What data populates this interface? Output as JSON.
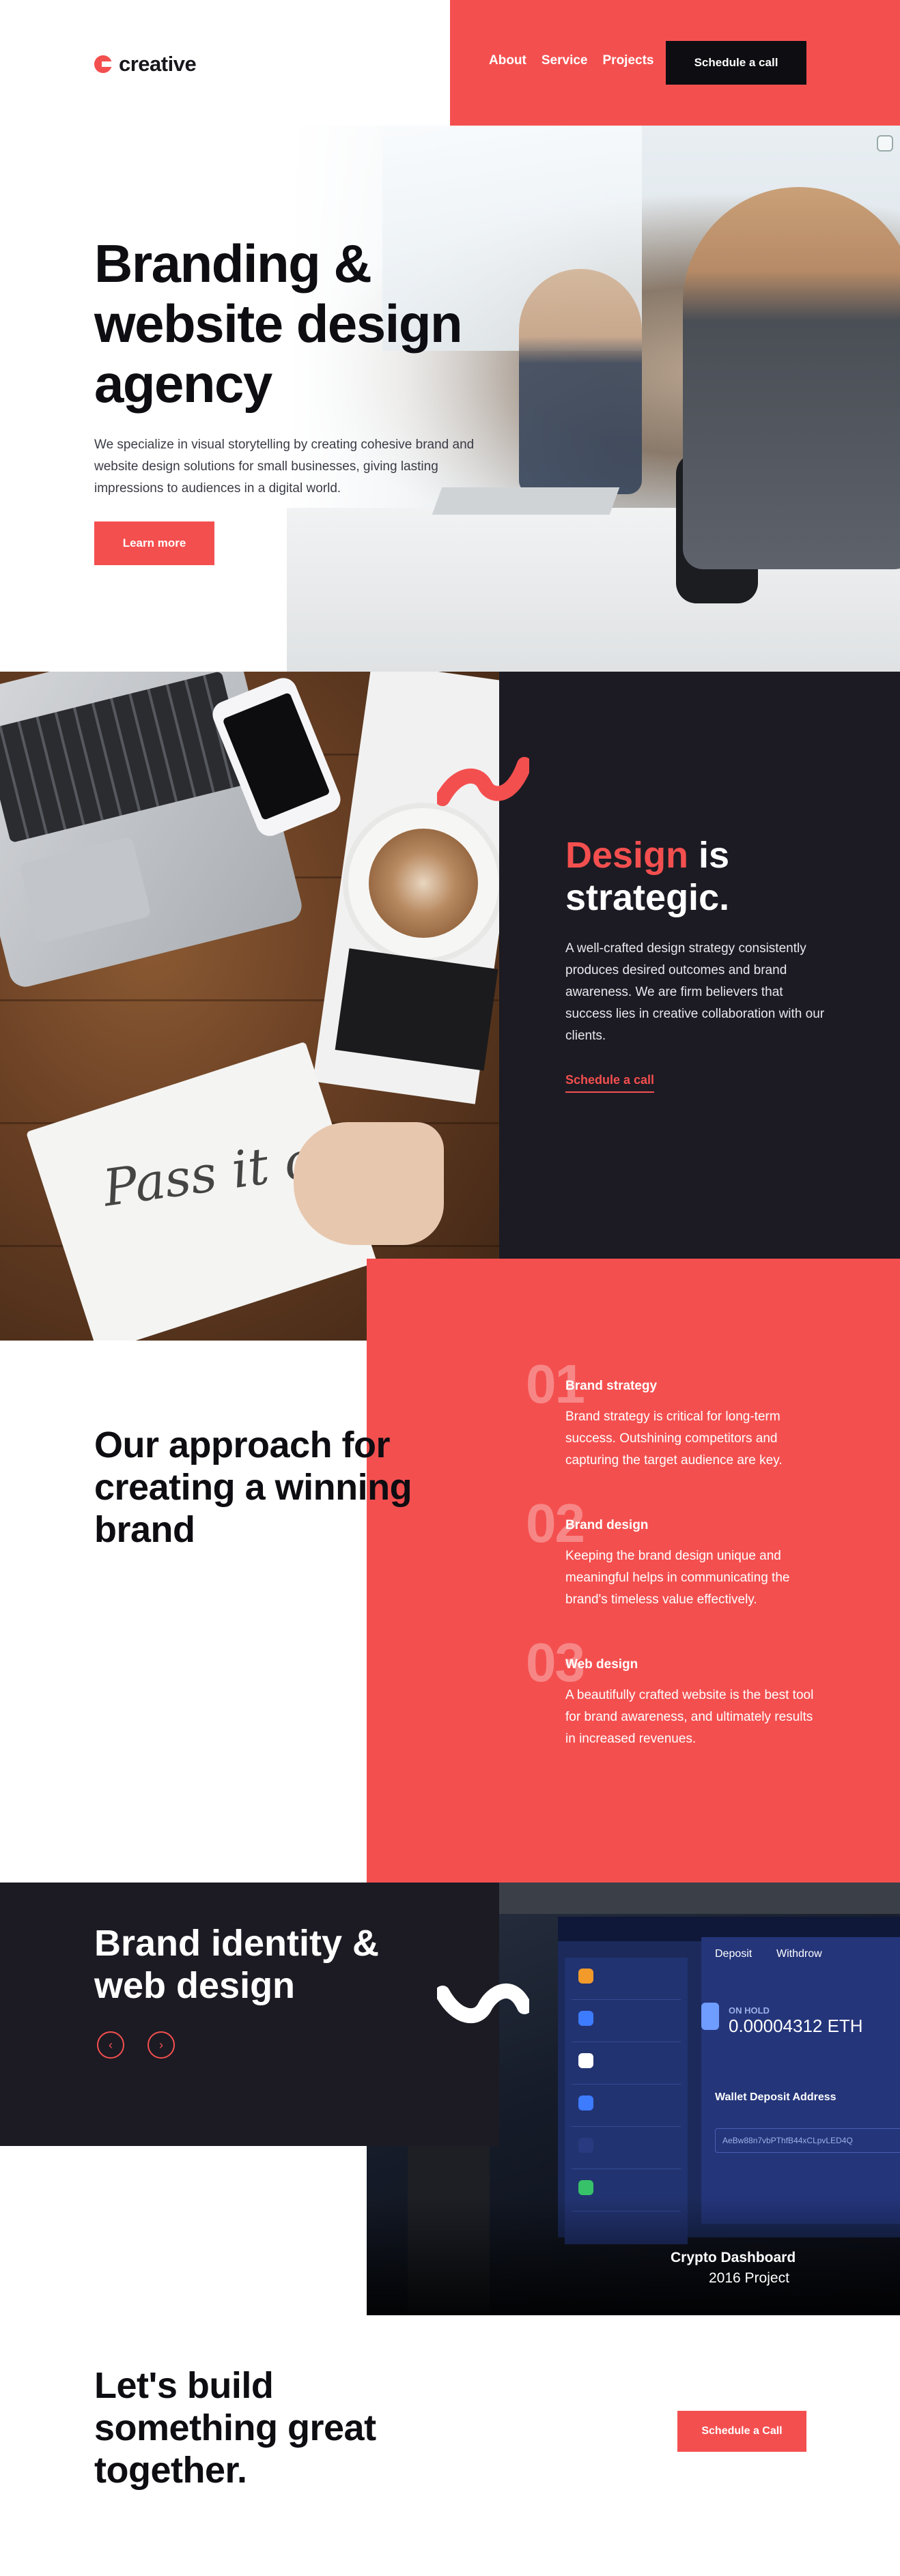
{
  "header": {
    "logo_text": "creative",
    "nav": [
      "About",
      "Service",
      "Projects"
    ],
    "cta_label": "Schedule a call"
  },
  "hero": {
    "title": "Branding & website design agency",
    "text": "We specialize in visual storytelling by creating cohesive brand and website design solutions for small businesses, giving lasting impressions to audiences in a digital world.",
    "button_label": "Learn more"
  },
  "design": {
    "title_red": "Design",
    "title_rest": " is strategic.",
    "text": "A well-crafted design strategy consistently produces desired outcomes and brand awareness. We are firm believers that success lies in creative collaboration with our clients.",
    "link_label": "Schedule a call"
  },
  "approach": {
    "title": "Our approach for creating a winning brand",
    "steps": [
      {
        "num": "01",
        "title": "Brand strategy",
        "text": "Brand strategy is critical for long-term success. Outshining competitors and capturing the target audience are key."
      },
      {
        "num": "02",
        "title": "Brand design",
        "text": "Keeping the brand design unique and meaningful helps in communicating the brand's timeless value effectively."
      },
      {
        "num": "03",
        "title": "Web design",
        "text": "A beautifully crafted website is the best tool for brand awareness, and ultimately results in increased revenues."
      }
    ]
  },
  "portfolio": {
    "title": "Brand identity & web design",
    "prev_icon": "chevron-left-icon",
    "next_icon": "chevron-right-icon",
    "project_title": "Crypto Dashboard",
    "project_sub": "2016 Project"
  },
  "cta": {
    "title": "Let's build something great together.",
    "button_label": "Schedule a Call"
  },
  "colors": {
    "accent": "#f44f4f",
    "dark": "#1c1b23",
    "black": "#0d0d12"
  }
}
